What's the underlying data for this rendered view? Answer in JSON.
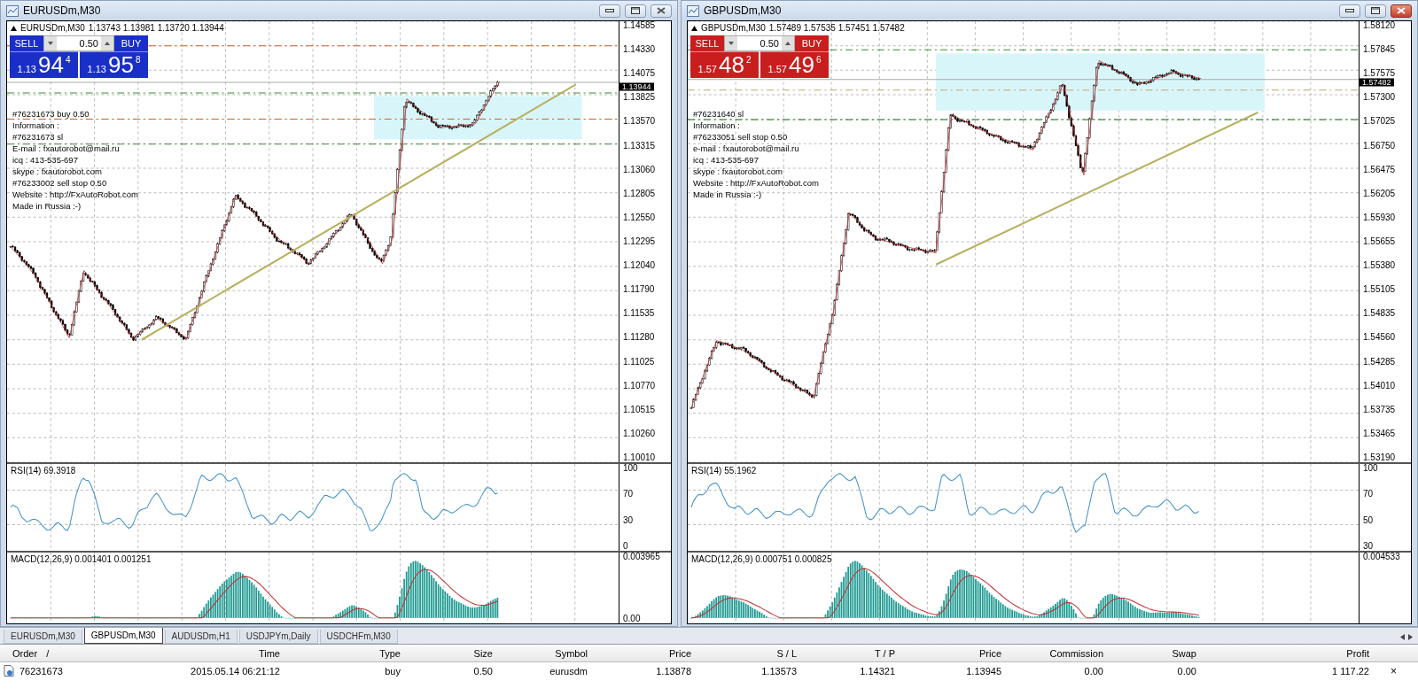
{
  "charts": [
    {
      "title": "EURUSDm,M30",
      "active": false,
      "color": "#1a2fc8",
      "header": "EURUSDm,M30",
      "ohlc": "1.13743 1.13981 1.13720 1.13944",
      "trade": {
        "sell": "SELL",
        "buy": "BUY",
        "lot": "0.50",
        "bid": {
          "prefix": "1.13",
          "pips": "94",
          "fraction": "4"
        },
        "ask": {
          "prefix": "1.13",
          "pips": "95",
          "fraction": "8"
        }
      },
      "lines": [
        "#76231673 buy 0.50",
        "Information :",
        "#76231673 sl",
        "E-mail : fxautorobot@mail.ru",
        "icq : 413-535-697",
        "skype : fxautorobot.com",
        "#76233002 sell stop 0.50",
        "Website : http://FxAutoRobot.com",
        "Made in Russia :-)"
      ],
      "price_ticks": [
        "1.14585",
        "1.14330",
        "1.14075",
        "1.13825",
        "1.13570",
        "1.13315",
        "1.13060",
        "1.12805",
        "1.12550",
        "1.12295",
        "1.12040",
        "1.11790",
        "1.11535",
        "1.11280",
        "1.11025",
        "1.10770",
        "1.10515",
        "1.10260",
        "1.10010"
      ],
      "current_price": "1.13944",
      "rsi": {
        "label": "RSI(14) 69.3918",
        "ticks": [
          "100",
          "70",
          "30",
          "0"
        ]
      },
      "macd": {
        "label": "MACD(12,26,9) 0.001401 0.001251",
        "ticks": [
          "0.003965",
          "0.00"
        ]
      }
    },
    {
      "title": "GBPUSDm,M30",
      "active": true,
      "color": "#c81e1e",
      "header": "GBPUSDm,M30",
      "ohlc": "1.57489 1.57535 1.57451 1.57482",
      "trade": {
        "sell": "SELL",
        "buy": "BUY",
        "lot": "0.50",
        "bid": {
          "prefix": "1.57",
          "pips": "48",
          "fraction": "2"
        },
        "ask": {
          "prefix": "1.57",
          "pips": "49",
          "fraction": "6"
        }
      },
      "lines": [
        "#76231640 sl",
        "Information :",
        "#76233051 sell stop 0.50",
        "e-mail : fxautorobot@mail.ru",
        "icq : 413-535-697",
        "skype : fxautorobot.com",
        "Website : http://FxAutoRobot.com",
        "Made in Russia :-)"
      ],
      "price_ticks": [
        "1.58120",
        "1.57845",
        "1.57575",
        "1.57300",
        "1.57025",
        "1.56750",
        "1.56475",
        "1.56205",
        "1.55930",
        "1.55655",
        "1.55380",
        "1.55105",
        "1.54835",
        "1.54560",
        "1.54285",
        "1.54010",
        "1.53735",
        "1.53465",
        "1.53190"
      ],
      "current_price": "1.57482",
      "rsi": {
        "label": "RSI(14) 55.1962",
        "ticks": [
          "100",
          "70",
          "50",
          "30"
        ]
      },
      "macd": {
        "label": "MACD(12,26,9) 0.000751 0.000825",
        "ticks": [
          "0.004533"
        ]
      }
    }
  ],
  "tabs": [
    {
      "label": "EURUSDm,M30",
      "selected": false
    },
    {
      "label": "GBPUSDm,M30",
      "selected": true
    },
    {
      "label": "AUDUSDm,H1",
      "selected": false
    },
    {
      "label": "USDJPYm,Daily",
      "selected": false
    },
    {
      "label": "USDCHFm,M30",
      "selected": false
    }
  ],
  "table": {
    "columns": [
      "Order",
      "Time",
      "Type",
      "Size",
      "Symbol",
      "Price",
      "S / L",
      "T / P",
      "Price",
      "Commission",
      "Swap",
      "Profit"
    ],
    "sort_mark": "/",
    "rows": [
      [
        "76231673",
        "2015.05.14 06:21:12",
        "buy",
        "0.50",
        "eurusdm",
        "1.13878",
        "1.13573",
        "1.14321",
        "1.13945",
        "0.00",
        "0.00",
        "1 117.22"
      ]
    ],
    "close": "×"
  }
}
